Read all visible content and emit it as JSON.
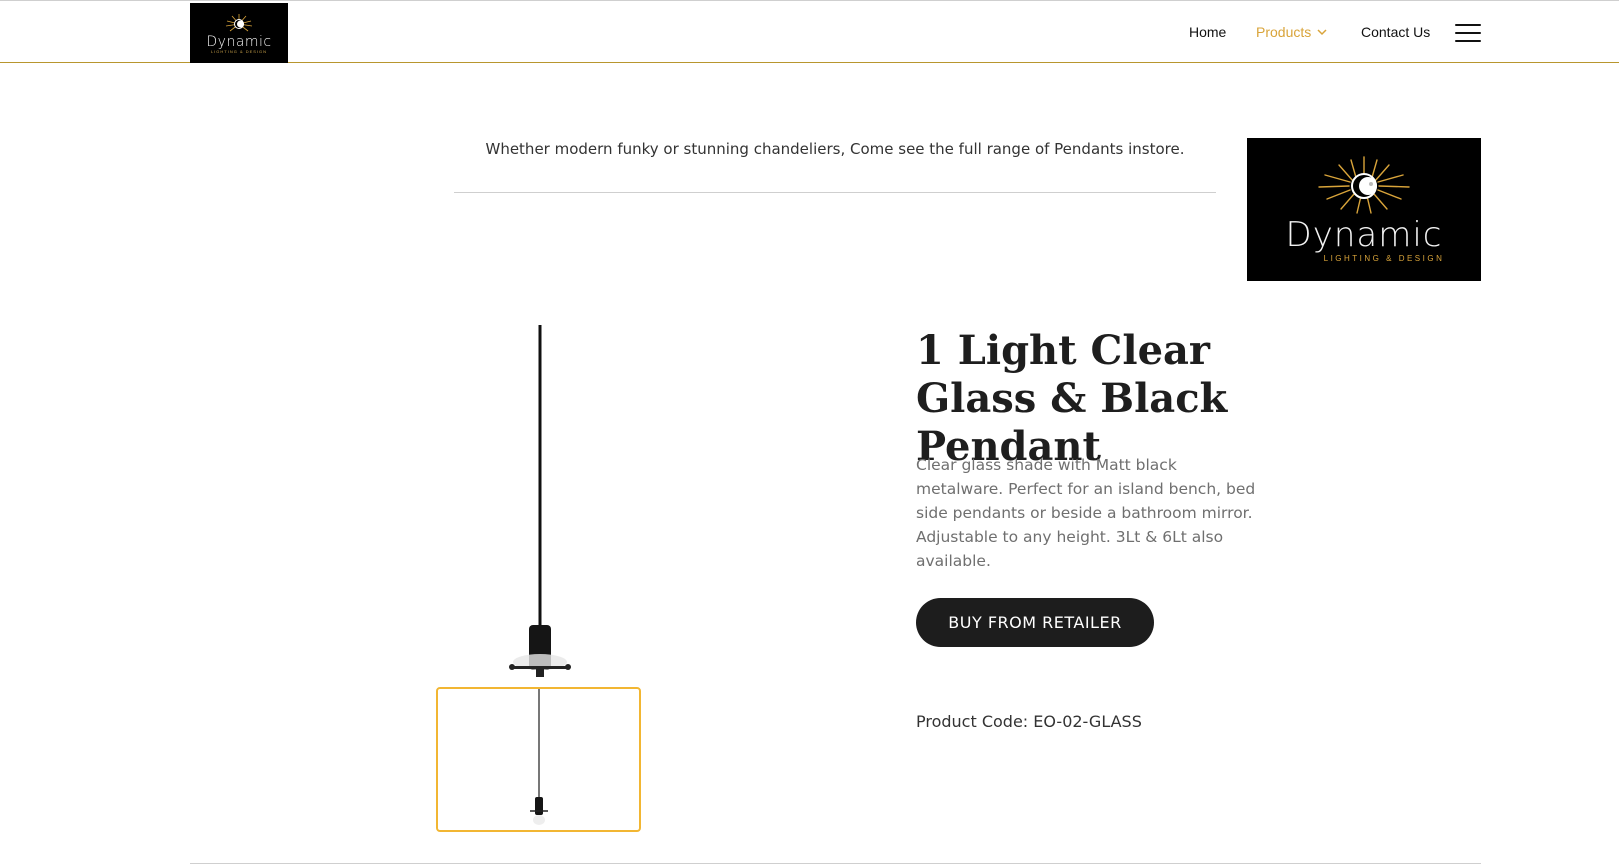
{
  "header": {
    "logo": {
      "brand": "Dynamic",
      "tagline": "LIGHTING & DESIGN"
    },
    "nav": {
      "home": "Home",
      "products": "Products",
      "contact": "Contact Us"
    }
  },
  "intro": {
    "text": "Whether modern funky or stunning chandeliers, Come see the full range of Pendants instore."
  },
  "side_logo": {
    "brand": "Dynamic",
    "tagline": "LIGHTING & DESIGN"
  },
  "product": {
    "title": "1 Light Clear Glass & Black Pendant",
    "description": "Clear glass shade with Matt black metalware. Perfect for an island bench, bed side pendants or beside a bathroom mirror. Adjustable to any height. 3Lt & 6Lt also available.",
    "buy_label": "BUY FROM RETAILER",
    "code": "Product Code: EO-02-GLASS"
  },
  "colors": {
    "accent": "#d9a43a",
    "thumb_border": "#f2b632",
    "button": "#1d1d1d"
  }
}
